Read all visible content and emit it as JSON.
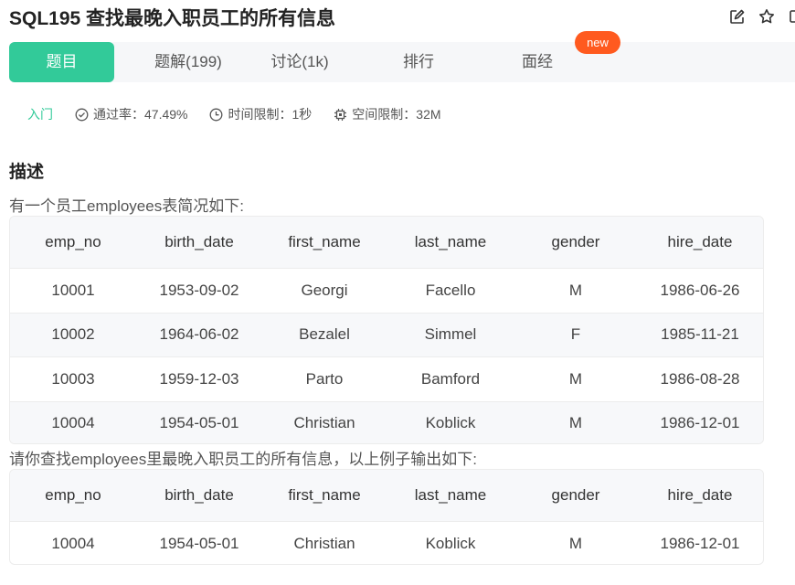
{
  "header": {
    "title": "SQL195  查找最晚入职员工的所有信息",
    "actions": [
      {
        "icon": "edit-icon"
      },
      {
        "icon": "star-icon"
      },
      {
        "icon": "panel-icon"
      }
    ]
  },
  "tabs": [
    {
      "label": "题目",
      "active": true
    },
    {
      "label": "题解(199)",
      "active": false
    },
    {
      "label": "讨论(1k)",
      "active": false
    },
    {
      "label": "排行",
      "active": false
    },
    {
      "label": "面经",
      "active": false
    }
  ],
  "new_badge": "new",
  "meta": {
    "level": "入门",
    "pass_rate": "通过率：47.49%",
    "time_limit": "时间限制：1秒",
    "space_limit": "空间限制：32M"
  },
  "description": {
    "heading": "描述",
    "intro": "有一个员工employees表简况如下:",
    "request": "请你查找employees里最晚入职员工的所有信息，以上例子输出如下:"
  },
  "table_columns": [
    "emp_no",
    "birth_date",
    "first_name",
    "last_name",
    "gender",
    "hire_date"
  ],
  "employees_rows": [
    [
      "10001",
      "1953-09-02",
      "Georgi",
      "Facello",
      "M",
      "1986-06-26"
    ],
    [
      "10002",
      "1964-06-02",
      "Bezalel",
      "Simmel",
      "F",
      "1985-11-21"
    ],
    [
      "10003",
      "1959-12-03",
      "Parto",
      "Bamford",
      "M",
      "1986-08-28"
    ],
    [
      "10004",
      "1954-05-01",
      "Christian",
      "Koblick",
      "M",
      "1986-12-01"
    ]
  ],
  "output_rows": [
    [
      "10004",
      "1954-05-01",
      "Christian",
      "Koblick",
      "M",
      "1986-12-01"
    ]
  ],
  "colors": {
    "accent": "#32ca99",
    "badge": "#ff5a1f"
  }
}
